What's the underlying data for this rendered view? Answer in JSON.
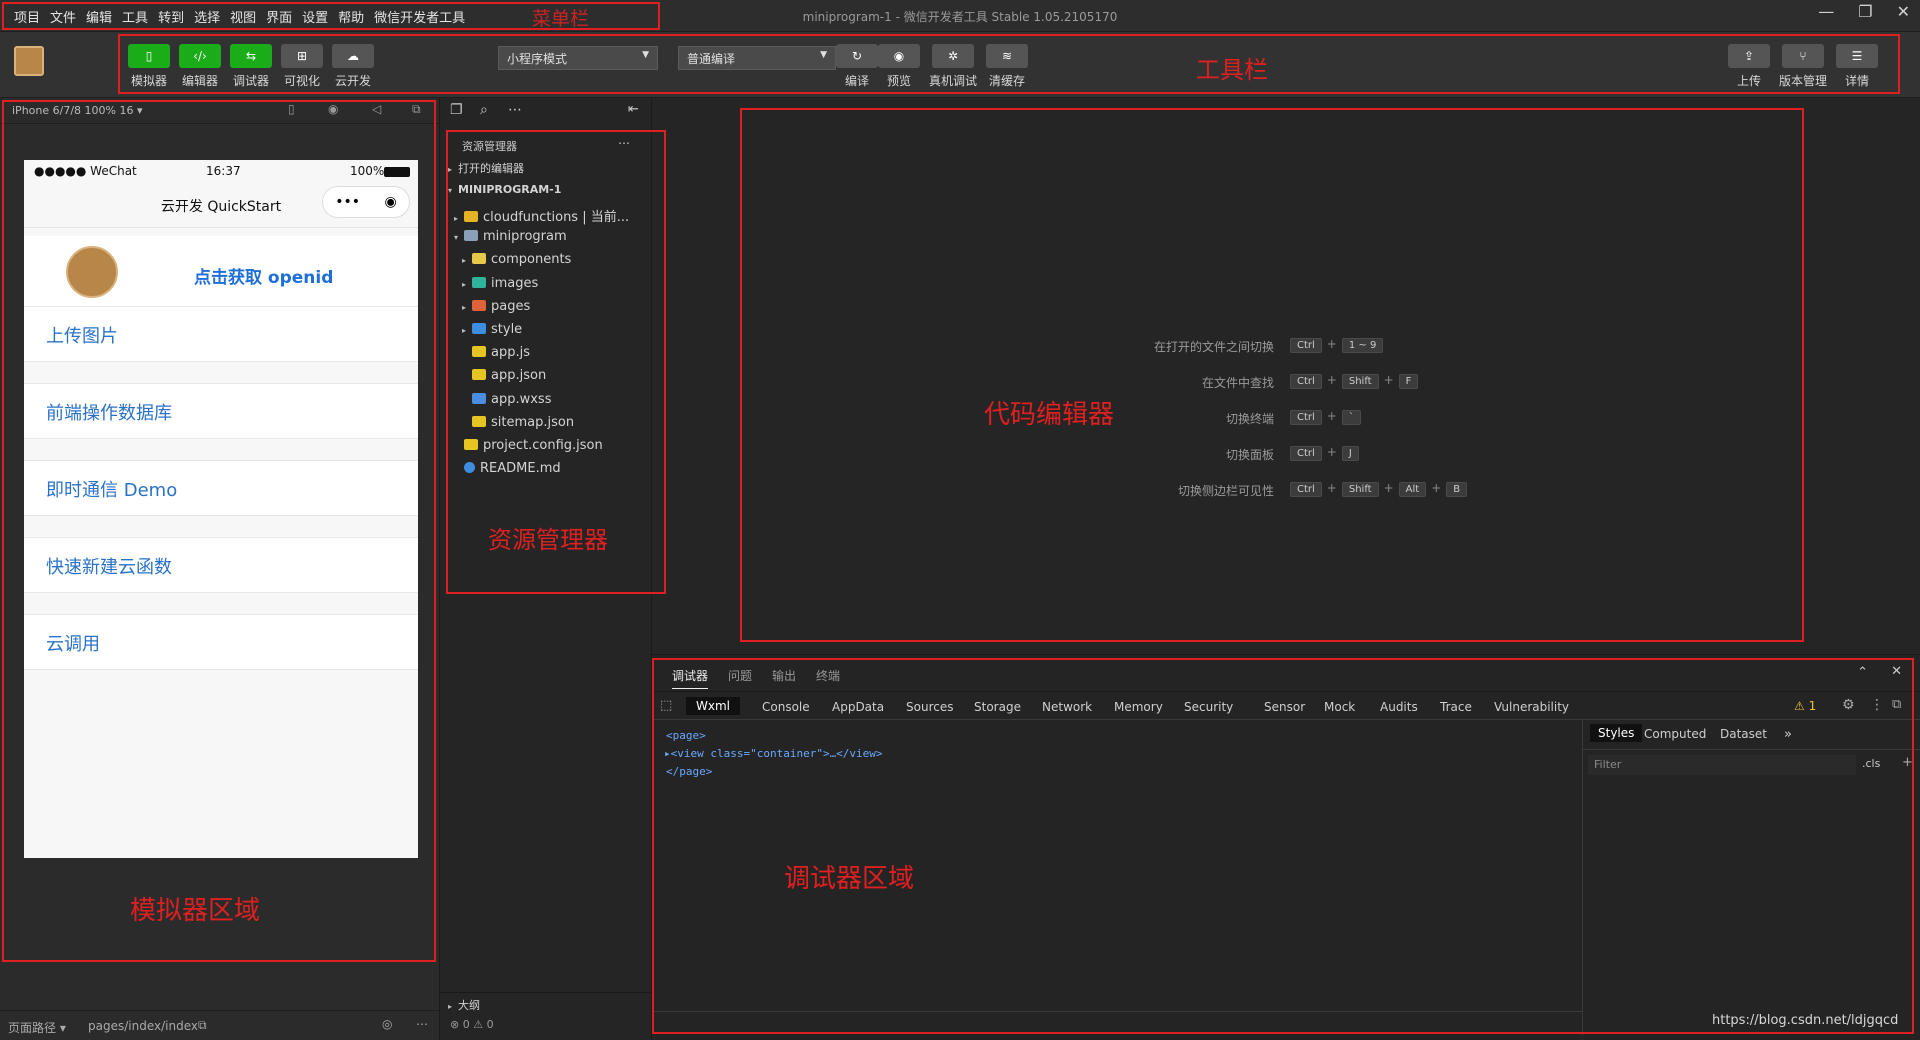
{
  "menubar": {
    "items": [
      "项目",
      "文件",
      "编辑",
      "工具",
      "转到",
      "选择",
      "视图",
      "界面",
      "设置",
      "帮助",
      "微信开发者工具"
    ],
    "title": "miniprogram-1 - 微信开发者工具 Stable 1.05.2105170",
    "label": "菜单栏"
  },
  "toolbar": {
    "label": "工具栏",
    "left_buttons": [
      "模拟器",
      "编辑器",
      "调试器",
      "可视化",
      "云开发"
    ],
    "mode_select": "小程序模式",
    "compile_select": "普通编译",
    "mid_buttons": [
      "编译",
      "预览",
      "真机调试",
      "清缓存"
    ],
    "right_buttons": [
      "上传",
      "版本管理",
      "详情"
    ]
  },
  "simulator": {
    "label": "模拟器区域",
    "device": "iPhone 6/7/8 100% 16 ▾",
    "status_carrier": "●●●●● WeChat",
    "status_time": "16:37",
    "status_battery": "100%",
    "nav_title": "云开发 QuickStart",
    "openid_button": "点击获取 openid",
    "list_items": [
      "上传图片",
      "前端操作数据库",
      "即时通信 Demo",
      "快速新建云函数",
      "云调用"
    ],
    "footer_path_label": "页面路径 ▾",
    "footer_path": "pages/index/index"
  },
  "explorer": {
    "label": "资源管理器",
    "header": "资源管理器",
    "open_editors": "打开的编辑器",
    "project": "MINIPROGRAM-1",
    "tree": [
      {
        "name": "cloudfunctions | 当前...",
        "kind": "folder",
        "color": "#e6b422",
        "indent": 1,
        "arrow": "▸"
      },
      {
        "name": "miniprogram",
        "kind": "folder-open",
        "color": "#8aa0b8",
        "indent": 1,
        "arrow": "▾"
      },
      {
        "name": "components",
        "kind": "folder",
        "color": "#e6c84a",
        "indent": 2,
        "arrow": "▸"
      },
      {
        "name": "images",
        "kind": "folder",
        "color": "#2fb39a",
        "indent": 2,
        "arrow": "▸"
      },
      {
        "name": "pages",
        "kind": "folder",
        "color": "#e0623a",
        "indent": 2,
        "arrow": "▸"
      },
      {
        "name": "style",
        "kind": "folder",
        "color": "#3f8de0",
        "indent": 2,
        "arrow": "▸"
      },
      {
        "name": "app.js",
        "kind": "js",
        "color": "#e6c422",
        "indent": 2,
        "arrow": ""
      },
      {
        "name": "app.json",
        "kind": "json",
        "color": "#e6c422",
        "indent": 2,
        "arrow": ""
      },
      {
        "name": "app.wxss",
        "kind": "wxss",
        "color": "#4a8ee0",
        "indent": 2,
        "arrow": ""
      },
      {
        "name": "sitemap.json",
        "kind": "json",
        "color": "#e6c422",
        "indent": 2,
        "arrow": ""
      },
      {
        "name": "project.config.json",
        "kind": "json",
        "color": "#e6c422",
        "indent": 1,
        "arrow": ""
      },
      {
        "name": "README.md",
        "kind": "info",
        "color": "#3f8de0",
        "indent": 1,
        "arrow": ""
      }
    ],
    "outline": "大纲",
    "status": "⊗ 0 ⚠ 0"
  },
  "editor": {
    "label": "代码编辑器",
    "shortcuts": [
      {
        "desc": "在打开的文件之间切换",
        "keys": [
          "Ctrl",
          "1 ~ 9"
        ]
      },
      {
        "desc": "在文件中查找",
        "keys": [
          "Ctrl",
          "Shift",
          "F"
        ]
      },
      {
        "desc": "切换终端",
        "keys": [
          "Ctrl",
          "`"
        ]
      },
      {
        "desc": "切换面板",
        "keys": [
          "Ctrl",
          "J"
        ]
      },
      {
        "desc": "切换侧边栏可见性",
        "keys": [
          "Ctrl",
          "Shift",
          "Alt",
          "B"
        ]
      }
    ]
  },
  "debugger": {
    "label": "调试器区域",
    "top_tabs": [
      "调试器",
      "问题",
      "输出",
      "终端"
    ],
    "devtools_tabs": [
      "Wxml",
      "Console",
      "AppData",
      "Sources",
      "Storage",
      "Network",
      "Memory",
      "Security",
      "Sensor",
      "Mock",
      "Audits",
      "Trace",
      "Vulnerability"
    ],
    "warning_count": "⚠ 1",
    "code_lines": [
      "<page>",
      "▸<view class=\"container\">…</view>",
      "</page>"
    ],
    "style_tabs": [
      "Styles",
      "Computed",
      "Dataset"
    ],
    "filter_placeholder": "Filter",
    "cls": ".cls",
    "watermark": "https://blog.csdn.net/ldjgqcd"
  }
}
